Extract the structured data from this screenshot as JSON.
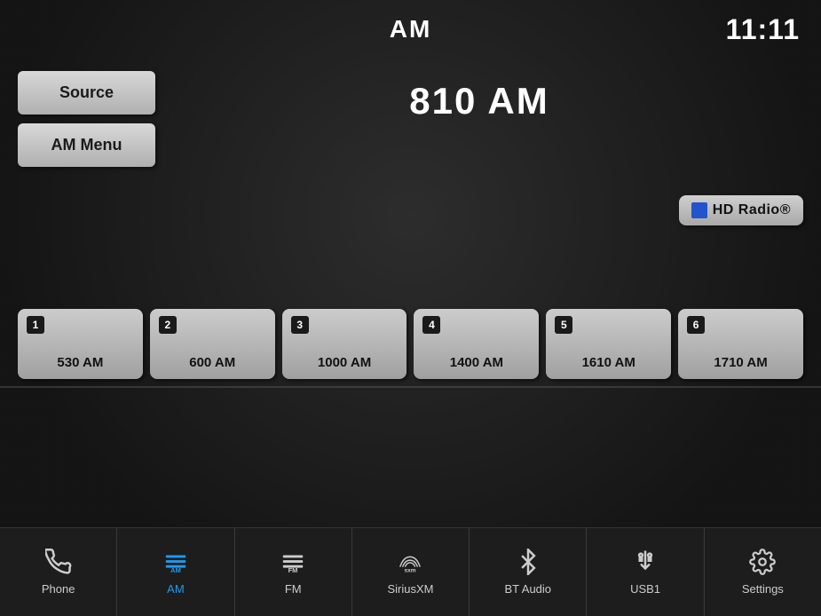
{
  "header": {
    "mode": "AM",
    "clock": "11:11"
  },
  "controls": {
    "source_label": "Source",
    "menu_label": "AM Menu"
  },
  "frequency": {
    "display": "810 AM"
  },
  "hd_radio": {
    "label": "HD Radio®"
  },
  "presets": [
    {
      "num": "1",
      "freq": "530 AM"
    },
    {
      "num": "2",
      "freq": "600 AM"
    },
    {
      "num": "3",
      "freq": "1000 AM"
    },
    {
      "num": "4",
      "freq": "1400 AM"
    },
    {
      "num": "5",
      "freq": "1610 AM"
    },
    {
      "num": "6",
      "freq": "1710 AM"
    }
  ],
  "nav": [
    {
      "id": "phone",
      "label": "Phone",
      "icon": "phone",
      "active": false
    },
    {
      "id": "am",
      "label": "AM",
      "icon": "am",
      "active": true
    },
    {
      "id": "fm",
      "label": "FM",
      "icon": "fm",
      "active": false
    },
    {
      "id": "siriusxm",
      "label": "SiriusXM",
      "icon": "sxm",
      "active": false
    },
    {
      "id": "bt-audio",
      "label": "BT Audio",
      "icon": "bt",
      "active": false
    },
    {
      "id": "usb1",
      "label": "USB1",
      "icon": "usb",
      "active": false
    },
    {
      "id": "settings",
      "label": "Settings",
      "icon": "settings",
      "active": false
    }
  ]
}
